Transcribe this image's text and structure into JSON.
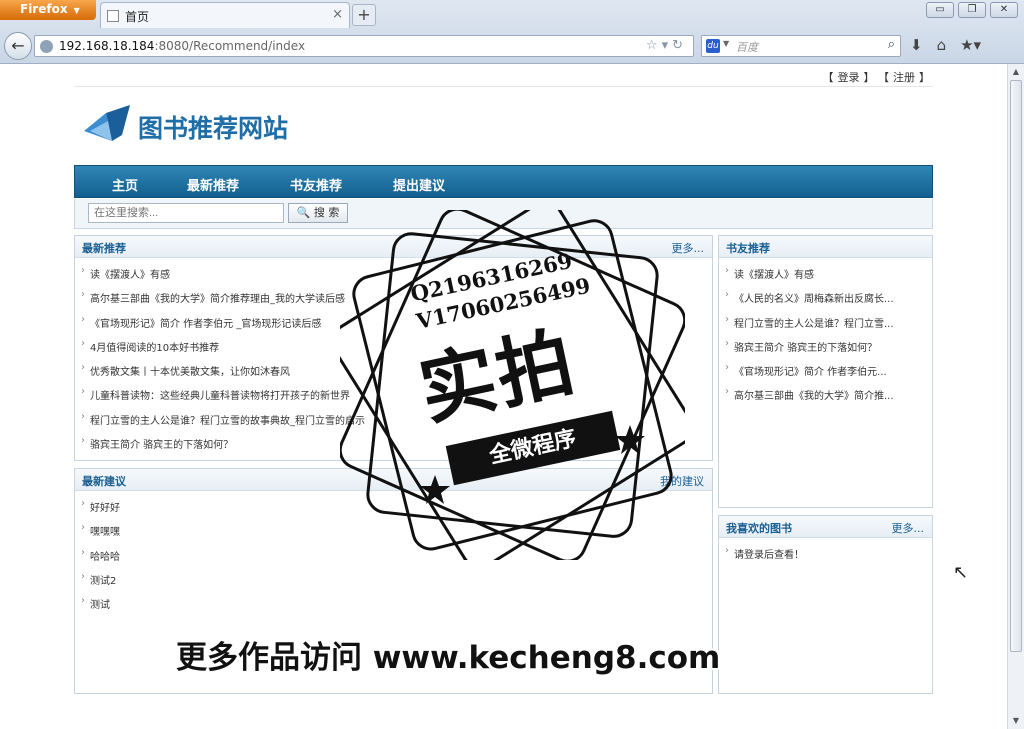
{
  "browser": {
    "app_button": "Firefox",
    "tab_title": "首页",
    "url_host": "192.168.18.184",
    "url_path": ":8080/Recommend/index",
    "search_placeholder": "百度",
    "win_controls": [
      "▭",
      "❐",
      "✕"
    ]
  },
  "top_links": {
    "login": "登录",
    "register": "注册"
  },
  "site": {
    "logo_text": "图书推荐网站",
    "accent": "#1f6ea8"
  },
  "menu": [
    "主页",
    "最新推荐",
    "书友推荐",
    "提出建议"
  ],
  "search": {
    "placeholder": "在这里搜索...",
    "button": "搜 索"
  },
  "latest_recommend": {
    "title": "最新推荐",
    "more": "更多...",
    "items": [
      "读《摆渡人》有感",
      "高尔基三部曲《我的大学》简介推荐理由_我的大学读后感",
      "《官场现形记》简介 作者李伯元 _官场现形记读后感",
      "4月值得阅读的10本好书推荐",
      "优秀散文集丨十本优美散文集，让你如沐春风",
      "儿童科普读物：这些经典儿童科普读物将打开孩子的新世界",
      "程门立雪的主人公是谁？程门立雪的故事典故_程门立雪的启示",
      "骆宾王简介 骆宾王的下落如何？"
    ]
  },
  "friend_recommend": {
    "title": "书友推荐",
    "items": [
      "读《摆渡人》有感",
      "《人民的名义》周梅森新出反腐长...",
      "程门立雪的主人公是谁？程门立雪...",
      "骆宾王简介 骆宾王的下落如何？",
      "《官场现形记》简介 作者李伯元...",
      "高尔基三部曲《我的大学》简介推..."
    ]
  },
  "latest_suggest": {
    "title": "最新建议",
    "more": "我的建议",
    "items": [
      "好好好",
      "嘿嘿嘿",
      "哈哈哈",
      "测试2",
      "测试"
    ]
  },
  "my_books": {
    "title": "我喜欢的图书",
    "more": "更多...",
    "items": [
      "请登录后查看！"
    ]
  },
  "overlay": {
    "contact_q": "Q2196316269",
    "contact_v": "V17060256499",
    "stamp_big": "实拍",
    "stamp_ribbon": "全微程序",
    "banner": "更多作品访问 www.kecheng8.com"
  }
}
